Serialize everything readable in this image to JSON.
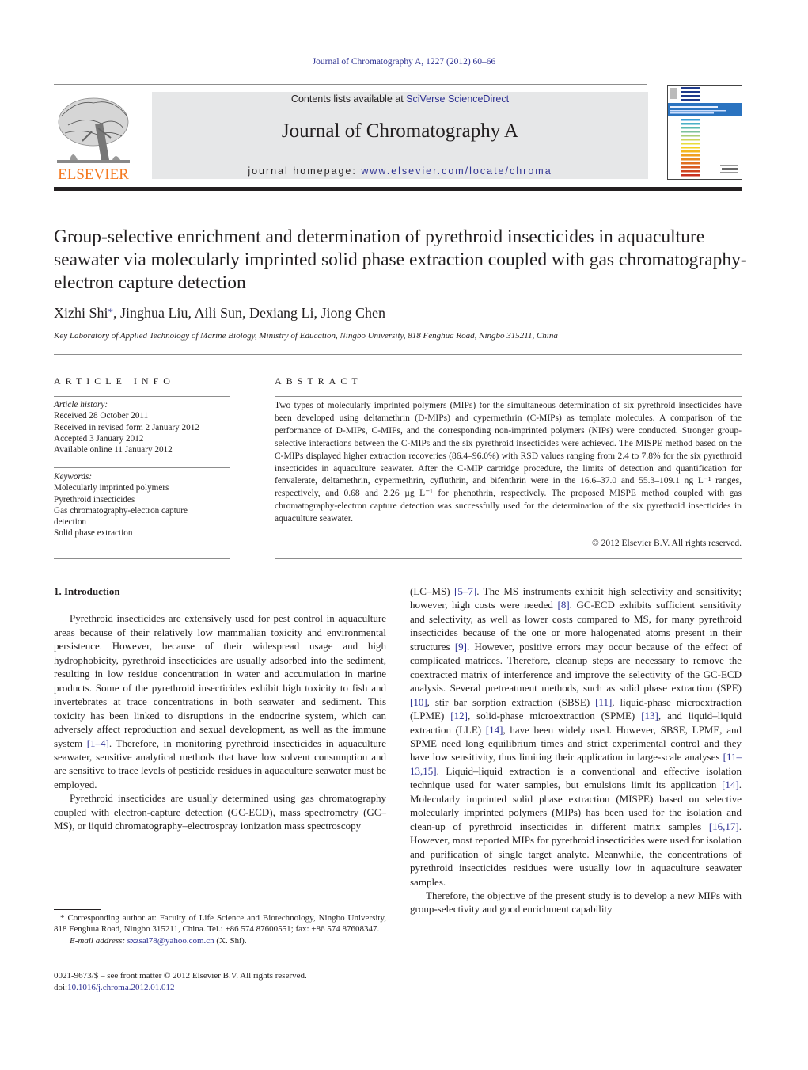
{
  "running_head": "Journal of Chromatography A, 1227 (2012) 60–66",
  "masthead": {
    "publisher": "ELSEVIER",
    "contents_prefix": "Contents lists available at ",
    "contents_link": "SciVerse ScienceDirect",
    "journal_name": "Journal of Chromatography A",
    "homepage_prefix": "journal homepage: ",
    "homepage_url": "www.elsevier.com/locate/chroma",
    "cover_alt": "Journal of Chromatography A cover",
    "accent_color": "#2e3192",
    "logo_color": "#f47920"
  },
  "article": {
    "title": "Group-selective enrichment and determination of pyrethroid insecticides in aquaculture seawater via molecularly imprinted solid phase extraction coupled with gas chromatography-electron capture detection",
    "authors": [
      {
        "name": "Xizhi Shi",
        "corresponding": true
      },
      {
        "name": "Jinghua Liu",
        "corresponding": false
      },
      {
        "name": "Aili Sun",
        "corresponding": false
      },
      {
        "name": "Dexiang Li",
        "corresponding": false
      },
      {
        "name": "Jiong Chen",
        "corresponding": false
      }
    ],
    "affiliation": "Key Laboratory of Applied Technology of Marine Biology, Ministry of Education, Ningbo University, 818 Fenghua Road, Ningbo 315211, China"
  },
  "article_info": {
    "heading": "ARTICLE INFO",
    "history_label": "Article history:",
    "history": [
      "Received 28 October 2011",
      "Received in revised form 2 January 2012",
      "Accepted 3 January 2012",
      "Available online 11 January 2012"
    ],
    "keywords_label": "Keywords:",
    "keywords": [
      "Molecularly imprinted polymers",
      "Pyrethroid insecticides",
      "Gas chromatography-electron capture detection",
      "Solid phase extraction"
    ]
  },
  "abstract": {
    "heading": "ABSTRACT",
    "text": "Two types of molecularly imprinted polymers (MIPs) for the simultaneous determination of six pyrethroid insecticides have been developed using deltamethrin (D-MIPs) and cypermethrin (C-MIPs) as template molecules. A comparison of the performance of D-MIPs, C-MIPs, and the corresponding non-imprinted polymers (NIPs) were conducted. Stronger group-selective interactions between the C-MIPs and the six pyrethroid insecticides were achieved. The MISPE method based on the C-MIPs displayed higher extraction recoveries (86.4–96.0%) with RSD values ranging from 2.4 to 7.8% for the six pyrethroid insecticides in aquaculture seawater. After the C-MIP cartridge procedure, the limits of detection and quantification for fenvalerate, deltamethrin, cypermethrin, cyfluthrin, and bifenthrin were in the 16.6–37.0 and 55.3–109.1 ng L⁻¹ ranges, respectively, and 0.68 and 2.26 µg L⁻¹ for phenothrin, respectively. The proposed MISPE method coupled with gas chromatography-electron capture detection was successfully used for the determination of the six pyrethroid insecticides in aquaculture seawater.",
    "copyright": "© 2012 Elsevier B.V. All rights reserved."
  },
  "body": {
    "section_heading": "1.  Introduction",
    "left_paragraphs": [
      [
        {
          "t": "Pyrethroid insecticides are extensively used for pest control in aquaculture areas because of their relatively low mammalian toxicity and environmental persistence. However, because of their widespread usage and high hydrophobicity, pyrethroid insecticides are usually adsorbed into the sediment, resulting in low residue concentration in water and accumulation in marine products. Some of the pyrethroid insecticides exhibit high toxicity to fish and invertebrates at trace concentrations in both seawater and sediment. This toxicity has been linked to disruptions in the endocrine system, which can adversely affect reproduction and sexual development, as well as the immune system "
        },
        {
          "ref": "[1–4]"
        },
        {
          "t": ". Therefore, in monitoring pyrethroid insecticides in aquaculture seawater, sensitive analytical methods that have low solvent consumption and are sensitive to trace levels of pesticide residues in aquaculture seawater must be employed."
        }
      ],
      [
        {
          "t": "Pyrethroid insecticides are usually determined using gas chromatography coupled with electron-capture detection (GC-ECD), mass spectrometry (GC–MS), or liquid chromatography–electrospray ionization mass spectroscopy"
        }
      ]
    ],
    "right_paragraphs": [
      [
        {
          "t": "(LC–MS) "
        },
        {
          "ref": "[5–7]"
        },
        {
          "t": ". The MS instruments exhibit high selectivity and sensitivity; however, high costs were needed "
        },
        {
          "ref": "[8]"
        },
        {
          "t": ". GC-ECD exhibits sufficient sensitivity and selectivity, as well as lower costs compared to MS, for many pyrethroid insecticides because of the one or more halogenated atoms present in their structures "
        },
        {
          "ref": "[9]"
        },
        {
          "t": ". However, positive errors may occur because of the effect of complicated matrices. Therefore, cleanup steps are necessary to remove the coextracted matrix of interference and improve the selectivity of the GC-ECD analysis. Several pretreatment methods, such as solid phase extraction (SPE) "
        },
        {
          "ref": "[10]"
        },
        {
          "t": ", stir bar sorption extraction (SBSE) "
        },
        {
          "ref": "[11]"
        },
        {
          "t": ", liquid-phase microextraction (LPME) "
        },
        {
          "ref": "[12]"
        },
        {
          "t": ", solid-phase microextraction (SPME) "
        },
        {
          "ref": "[13]"
        },
        {
          "t": ", and liquid–liquid extraction (LLE) "
        },
        {
          "ref": "[14]"
        },
        {
          "t": ", have been widely used. However, SBSE, LPME, and SPME need long equilibrium times and strict experimental control and they have low sensitivity, thus limiting their application in large-scale analyses "
        },
        {
          "ref": "[11–13,15]"
        },
        {
          "t": ". Liquid–liquid extraction is a conventional and effective isolation technique used for water samples, but emulsions limit its application "
        },
        {
          "ref": "[14]"
        },
        {
          "t": ". Molecularly imprinted solid phase extraction (MISPE) based on selective molecularly imprinted polymers (MIPs) has been used for the isolation and clean-up of pyrethroid insecticides in different matrix samples "
        },
        {
          "ref": "[16,17]"
        },
        {
          "t": ". However, most reported MIPs for pyrethroid insecticides were used for isolation and purification of single target analyte. Meanwhile, the concentrations of pyrethroid insecticides residues were usually low in aquaculture seawater samples."
        }
      ],
      [
        {
          "t": "Therefore, the objective of the present study is to develop a new MIPs with group-selectivity and good enrichment capability"
        }
      ]
    ]
  },
  "footnote": {
    "marker": "*",
    "text": "Corresponding author at: Faculty of Life Science and Biotechnology, Ningbo University, 818 Fenghua Road, Ningbo 315211, China. Tel.: +86 574 87600551; fax: +86 574 87608347.",
    "email_label": "E-mail address: ",
    "email": "sxzsal78@yahoo.com.cn",
    "email_suffix": " (X. Shi)."
  },
  "front_matter": {
    "issn_line": "0021-9673/$ – see front matter © 2012 Elsevier B.V. All rights reserved.",
    "doi_label": "doi:",
    "doi": "10.1016/j.chroma.2012.01.012"
  }
}
